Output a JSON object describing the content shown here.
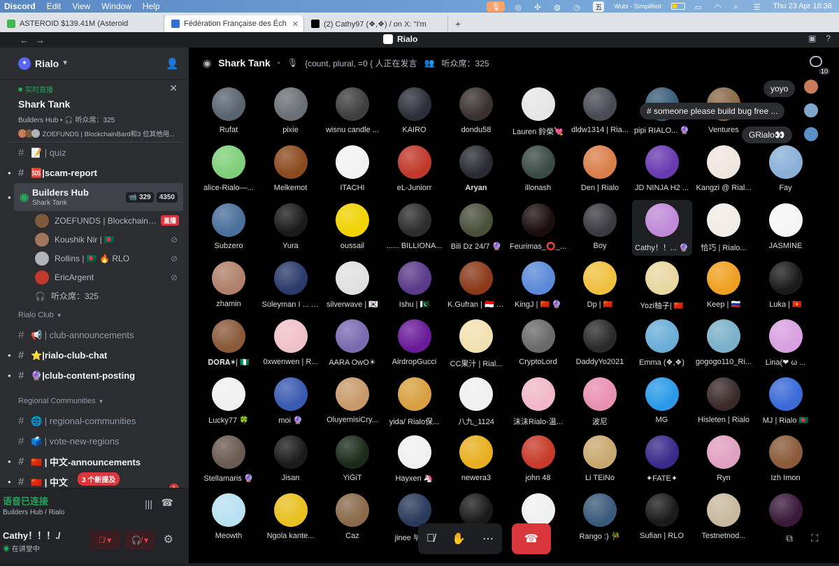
{
  "menubar": {
    "app": "Discord",
    "items": [
      "Edit",
      "View",
      "Window",
      "Help"
    ],
    "ime": "五",
    "ime_label": "Wubi - Simplified",
    "datetime": "Thu 23 Apr  18:36"
  },
  "browser_tabs": [
    {
      "title": "ASTEROID $139.41M (Asteroid",
      "fav_color": "#3fb950"
    },
    {
      "title": "Fédération Française des Éch",
      "fav_color": "#2f6fd6"
    },
    {
      "title": "(2) Cathy97 (❖,❖) / on X: \"I'm",
      "fav_color": "#000000"
    }
  ],
  "titlebar": {
    "title": "Rialo"
  },
  "server": {
    "name": "Rialo"
  },
  "live": {
    "label": "实时直播",
    "stage": "Shark Tank",
    "meta": "Builders Hub • 🎧 听众席：325",
    "speakers": "ZOEFUNDS | BlockchainBard和3 位其他用..."
  },
  "channels_top": [
    {
      "name": "📝 | quiz",
      "bold": false,
      "emo": "#c9a24a"
    },
    {
      "name": "🆘|scam-report",
      "bold": true,
      "emo": "#da373c",
      "caret": true
    }
  ],
  "voice_channel": {
    "name": "Builders Hub",
    "sub": "Shark Tank",
    "video_count": "329",
    "listener_count": "4350"
  },
  "voice_users": [
    {
      "name": "ZOEFUNDS | BlockchainB...",
      "color": "#7d5a3c",
      "live": "直播"
    },
    {
      "name": "Koushik Nir | 🇧🇩",
      "color": "#a0775a",
      "mute": true
    },
    {
      "name": "Rollins | 🇧🇩 🔥 RLO",
      "color": "#b0b3b8",
      "mute": true
    },
    {
      "name": "EricArgent",
      "color": "#c0392b",
      "mute": true
    }
  ],
  "listeners": "听众席：325",
  "category_club": "Rialo Club",
  "channels_club": [
    {
      "name": "📢 | club-announcements",
      "bold": false,
      "emo": "#8a8f98"
    },
    {
      "name": "⭐|rialo-club-chat",
      "bold": true,
      "emo": "#f0b232",
      "caret": true
    },
    {
      "name": "🔮|club-content-posting",
      "bold": true,
      "emo": "#7289da",
      "caret": true
    }
  ],
  "category_regional": "Regional Communities",
  "channels_regional": [
    {
      "name": "🌐 | regional-communities",
      "bold": false,
      "emo": "#3a8ee6"
    },
    {
      "name": "🗳️ | vote-new-regions",
      "bold": false,
      "emo": "#5a9bd4"
    },
    {
      "name": "🇨🇳 | 中文-announcements",
      "bold": true,
      "emo": "#de2910",
      "caret": true
    },
    {
      "name": "🇨🇳 | 中文",
      "bold": true,
      "emo": "#de2910",
      "caret": true
    }
  ],
  "new_mentions": "3 个新提及",
  "unread": "1",
  "voice_status": {
    "title": "语音已连接",
    "sub": "Builders Hub / Rialo"
  },
  "user": {
    "name": "Cathy！！！./",
    "status": "在讲堂中"
  },
  "stage_header": {
    "title": "Shark Tank",
    "speaking": "{count, plural, =0 { 人正在发言",
    "audience": "听众席：325",
    "inbox_count": "10"
  },
  "chat_bubbles": [
    {
      "text": "yoyo",
      "avatar": "#c97b5a"
    },
    {
      "text": "# someone please build bug free ...",
      "avatar": "#7fa7c9"
    },
    {
      "text": "GRialo👀",
      "avatar": "#5b8fc7"
    }
  ],
  "participants": [
    {
      "name": "Rufat",
      "color": "#5a6470"
    },
    {
      "name": "pixie",
      "color": "#6b6f76"
    },
    {
      "name": "wisnu candle ...",
      "color": "#3e3e3e"
    },
    {
      "name": "KAIRO",
      "color": "#2c2f3a"
    },
    {
      "name": "dondu58",
      "color": "#3a3030"
    },
    {
      "name": "Lauren 鈴榮💘",
      "color": "#e6e6e6"
    },
    {
      "name": "dldw1314 | Ria...",
      "color": "#4a4a55"
    },
    {
      "name": "pipi RIALO... 🔮",
      "color": "#3b5e7a"
    },
    {
      "name": "Ventures",
      "color": "#8a6a4a"
    },
    {
      "name": "",
      "color": "#000000"
    },
    {
      "name": "alice-Rialo—...",
      "color": "#7fcf7a"
    },
    {
      "name": "Melkemot",
      "color": "#8a4a1e"
    },
    {
      "name": "ITACHI",
      "color": "#f2f2f2"
    },
    {
      "name": "eL-Juniorr",
      "color": "#c0392b"
    },
    {
      "name": "Aryan",
      "color": "#2a2a33"
    },
    {
      "name": "illonash",
      "color": "#3a4a44"
    },
    {
      "name": "Den | Rialo",
      "color": "#d9804a"
    },
    {
      "name": "JD NINJA H2 ...",
      "color": "#6a3ab0"
    },
    {
      "name": "Kangzi @ Rial...",
      "color": "#f0e6e0"
    },
    {
      "name": "Fay",
      "color": "#8ab0d8"
    },
    {
      "name": "Subzero",
      "color": "#4a6f9a"
    },
    {
      "name": "Yura",
      "color": "#1a1a1a"
    },
    {
      "name": "oussail",
      "color": "#f2d200"
    },
    {
      "name": "...... BILLIONA...",
      "color": "#2c2c2c"
    },
    {
      "name": "Bili Dz 24/7 🔮",
      "color": "#4a4f3a"
    },
    {
      "name": "Feurimas_⭕_...",
      "color": "#1a0d0d"
    },
    {
      "name": "Boy",
      "color": "#3a3a40"
    },
    {
      "name": "Cathy！！... 🔮",
      "color": "#c08ad8"
    },
    {
      "name": "恰巧 | Rialo...",
      "color": "#f2ece6"
    },
    {
      "name": "JASMINE",
      "color": "#f5f5f5"
    },
    {
      "name": "zhamin",
      "color": "#b0806a"
    },
    {
      "name": "Süleyman I ... 🔮",
      "color": "#2a3a6a"
    },
    {
      "name": "silverwave | 🇰🇷",
      "color": "#e0e0e0"
    },
    {
      "name": "Ishu | 🇵🇰",
      "color": "#5a3a8a"
    },
    {
      "name": "K.Gufran | 🇮🇩 🔮",
      "color": "#8a3a1a"
    },
    {
      "name": "KingJ | 🇨🇳 🔮",
      "color": "#5a8ad8"
    },
    {
      "name": "Dp | 🇨🇳",
      "color": "#f0c040"
    },
    {
      "name": "Yozi柚子| 🇨🇳",
      "color": "#e8d8a0"
    },
    {
      "name": "Keep | 🇷🇺",
      "color": "#f0a020"
    },
    {
      "name": "Luka | 🇻🇳",
      "color": "#1a1a1a"
    },
    {
      "name": "𝐃𝐎𝐑𝐀✶| 🇳🇬",
      "color": "#8a5a3a"
    },
    {
      "name": "0xwenwen | R...",
      "color": "#f0c0c8"
    },
    {
      "name": "AARA OwO☀",
      "color": "#7a6ab0"
    },
    {
      "name": "AirdropGucci",
      "color": "#6a1a9a"
    },
    {
      "name": "CC果汁 | Rial...",
      "color": "#f2e0b0"
    },
    {
      "name": "CryptoLord",
      "color": "#6a6a6a"
    },
    {
      "name": "DaddyYo2021",
      "color": "#2a2a2a"
    },
    {
      "name": "Emma (❖,❖)",
      "color": "#6aaed8"
    },
    {
      "name": "gogogo110_Ri...",
      "color": "#7ab0c8"
    },
    {
      "name": "Lina(❤ ω ...",
      "color": "#d8a0e0"
    },
    {
      "name": "Lucky77 🍀",
      "color": "#f0f0f0"
    },
    {
      "name": "moi 🔮",
      "color": "#3a5ab0"
    },
    {
      "name": "OluyemisiCry...",
      "color": "#c89a6a"
    },
    {
      "name": "yida/ Rialo保...",
      "color": "#d8a040"
    },
    {
      "name": "八九_1124",
      "color": "#f0f0f0"
    },
    {
      "name": "沫沫Rialo-温...",
      "color": "#f0b8c8"
    },
    {
      "name": "波尼",
      "color": "#e890b0"
    },
    {
      "name": "MG",
      "color": "#2a9ae8"
    },
    {
      "name": "Hisleten | Rialo",
      "color": "#3a2a2a"
    },
    {
      "name": "MJ | Rialo 🇧🇩",
      "color": "#3a6ad8"
    },
    {
      "name": "Stellamaris 🔮",
      "color": "#6a5a50"
    },
    {
      "name": "Jisan",
      "color": "#1a1a1a"
    },
    {
      "name": "YiĞiT",
      "color": "#1a2a1a"
    },
    {
      "name": "Hayxen 🦄",
      "color": "#f0f0f0"
    },
    {
      "name": "newera3",
      "color": "#e8b020"
    },
    {
      "name": "john 48",
      "color": "#c83a2a"
    },
    {
      "name": "Li TEiNo",
      "color": "#c8a870"
    },
    {
      "name": "✦FATE✦",
      "color": "#3a2a8a"
    },
    {
      "name": "Ryn",
      "color": "#e0a0c0"
    },
    {
      "name": "Izh Imon",
      "color": "#8a5a3a"
    },
    {
      "name": "Meowth",
      "color": "#b8e0f0"
    },
    {
      "name": "Ngola kante...",
      "color": "#e8c020"
    },
    {
      "name": "Caz",
      "color": "#8a6a4a"
    },
    {
      "name": "jinee 부자...",
      "color": "#2a3a5a"
    },
    {
      "name": "",
      "color": "#1a1a1a"
    },
    {
      "name": "...💜",
      "color": "#f0f0f0"
    },
    {
      "name": "Rango :) 🎋",
      "color": "#3a5a7a"
    },
    {
      "name": "Sufian | RLO",
      "color": "#1a1a1a"
    },
    {
      "name": "Testnetnod...",
      "color": "#c8b8a0"
    },
    {
      "name": "",
      "color": "#3a1a3a"
    }
  ]
}
